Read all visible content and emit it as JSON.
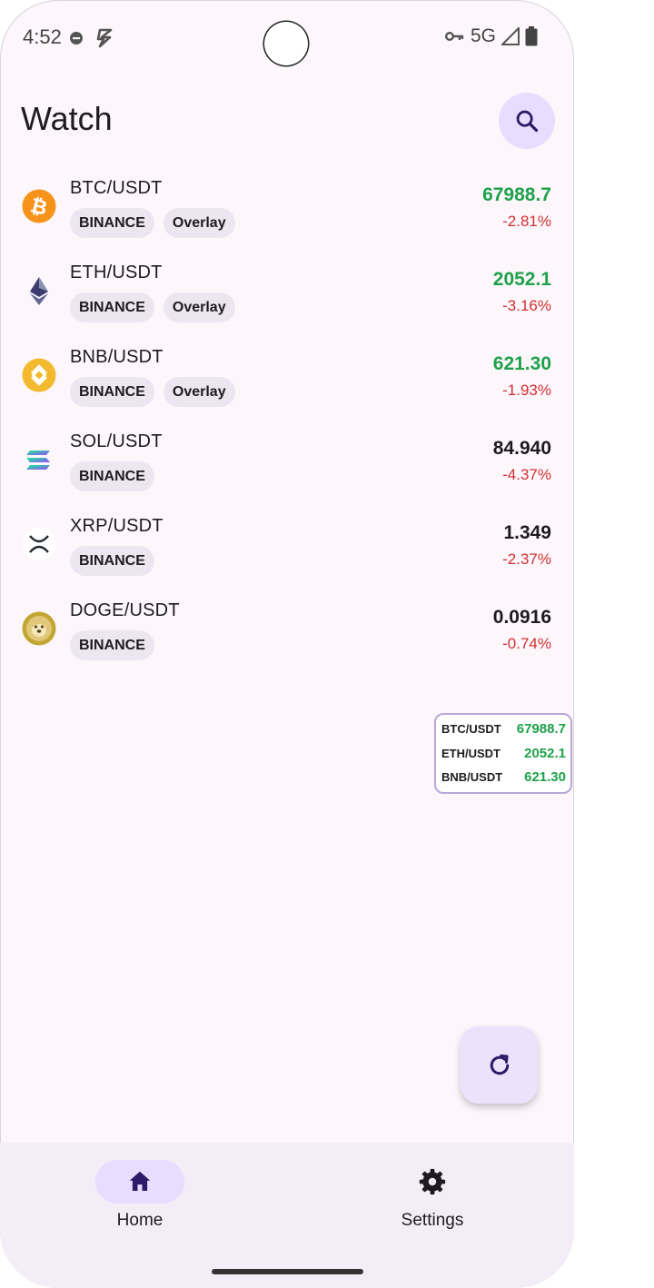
{
  "status_bar": {
    "time": "4:52",
    "network": "5G",
    "icons": [
      "do-not-disturb-icon",
      "bolt-icon",
      "vpn-key-icon",
      "signal-icon",
      "battery-icon"
    ]
  },
  "header": {
    "title": "Watch",
    "search_icon": "search-icon"
  },
  "colors": {
    "up": "#1ea14a",
    "down": "#d32f2f",
    "neutral": "#1d1b20",
    "accent": "#e9ddff"
  },
  "watchlist": [
    {
      "pair": "BTC/USDT",
      "icon": "bitcoin-icon",
      "chips": [
        "BINANCE",
        "Overlay"
      ],
      "price": "67988.7",
      "price_color": "#1ea14a",
      "change": "-2.81%"
    },
    {
      "pair": "ETH/USDT",
      "icon": "ethereum-icon",
      "chips": [
        "BINANCE",
        "Overlay"
      ],
      "price": "2052.1",
      "price_color": "#1ea14a",
      "change": "-3.16%"
    },
    {
      "pair": "BNB/USDT",
      "icon": "bnb-icon",
      "chips": [
        "BINANCE",
        "Overlay"
      ],
      "price": "621.30",
      "price_color": "#1ea14a",
      "change": "-1.93%"
    },
    {
      "pair": "SOL/USDT",
      "icon": "solana-icon",
      "chips": [
        "BINANCE"
      ],
      "price": "84.940",
      "price_color": "#1d1b20",
      "change": "-4.37%"
    },
    {
      "pair": "XRP/USDT",
      "icon": "xrp-icon",
      "chips": [
        "BINANCE"
      ],
      "price": "1.349",
      "price_color": "#1d1b20",
      "change": "-2.37%"
    },
    {
      "pair": "DOGE/USDT",
      "icon": "dogecoin-icon",
      "chips": [
        "BINANCE"
      ],
      "price": "0.0916",
      "price_color": "#1d1b20",
      "change": "-0.74%"
    }
  ],
  "overlay": [
    {
      "pair": "BTC/USDT",
      "price": "67988.7"
    },
    {
      "pair": "ETH/USDT",
      "price": "2052.1"
    },
    {
      "pair": "BNB/USDT",
      "price": "621.30"
    }
  ],
  "fab": {
    "icon": "refresh-icon"
  },
  "bottom_nav": {
    "items": [
      {
        "label": "Home",
        "icon": "home-icon",
        "selected": true
      },
      {
        "label": "Settings",
        "icon": "settings-icon",
        "selected": false
      }
    ]
  }
}
